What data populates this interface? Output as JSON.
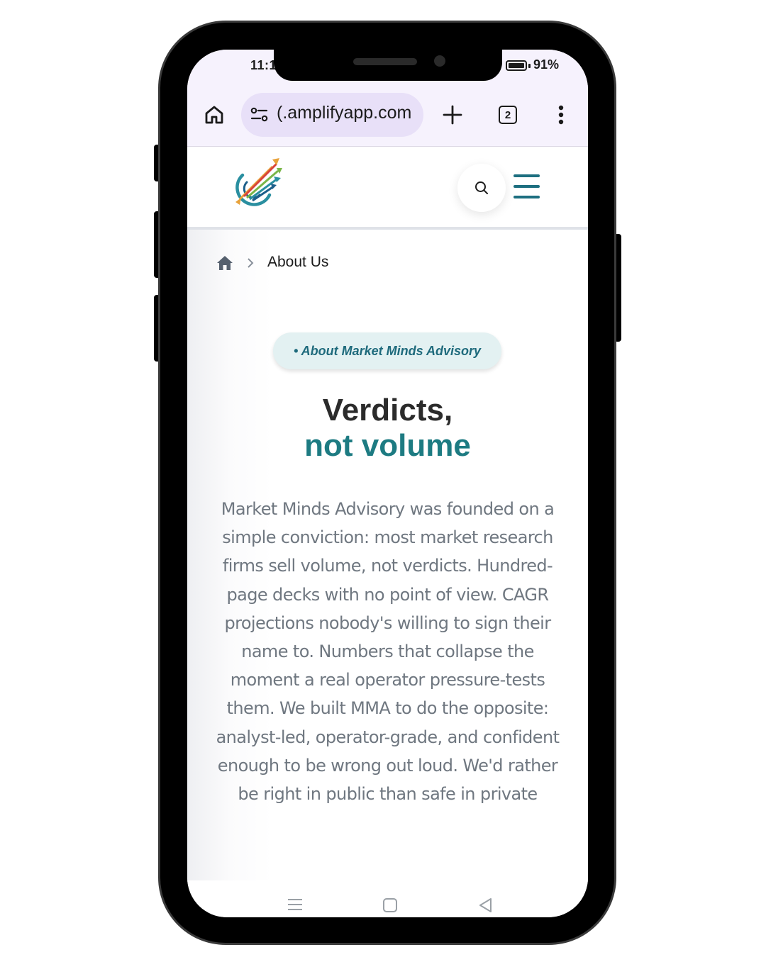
{
  "status_bar": {
    "time": "11:1",
    "battery_percent": "91%"
  },
  "browser": {
    "url": "(.amplifyapp.com",
    "tab_count": "2"
  },
  "site": {
    "breadcrumb_current": "About Us",
    "badge": "• About Market Minds Advisory",
    "title_line1": "Verdicts,",
    "title_line2": "not volume",
    "body": "Market Minds Advisory was founded on a simple conviction: most market research firms sell volume, not verdicts. Hundred-page decks with no point of view. CAGR projections nobody's willing to sign their name to. Numbers that collapse the moment a real operator pressure-tests them. We built MMA to do the opposite: analyst-led, operator-grade, and confident enough to be wrong out loud. We'd rather be right in public than safe in private"
  },
  "colors": {
    "accent_teal": "#1d7b82",
    "badge_bg": "#e3f1f2",
    "browser_bg": "#f6f2fd",
    "url_pill": "#e8e0f8"
  }
}
